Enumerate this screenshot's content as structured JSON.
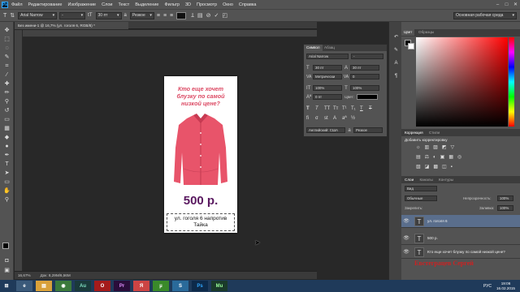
{
  "app": {
    "logo": "Ps"
  },
  "menu": [
    "Файл",
    "Редактирование",
    "Изображение",
    "Слои",
    "Текст",
    "Выделение",
    "Фильтр",
    "3D",
    "Просмотр",
    "Окно",
    "Справка"
  ],
  "options": {
    "font_family": "Arial Narrow",
    "font_style": "-",
    "font_size": "30 пт",
    "aa_label": "a",
    "aa_mode": "Резкое",
    "workspace": "Основная рабочая среда"
  },
  "document": {
    "tab_title": "Без имени-1 @ 16,7% (ул. гоголя 6, RGB/8) *",
    "zoom": "16,67%",
    "doc_info": "Док: 8,29M/6,56M",
    "headline": [
      "Кто еще хочет",
      "блузку по самой",
      "низкой цене?"
    ],
    "price": "500 р.",
    "address": [
      "ул. гоголя 6 напротив",
      "Тайка"
    ]
  },
  "character_panel": {
    "tabs": [
      "Символ",
      "Абзац"
    ],
    "font": "Arial Narrow",
    "style": "-",
    "size": "30 пт",
    "leading": "30 пт",
    "kerning": "Метрически",
    "tracking": "0",
    "scale_v": "100%",
    "scale_h": "100%",
    "baseline": "0 пт",
    "color_label": "Цвет:",
    "style_buttons": [
      "T",
      "T",
      "TT",
      "Tт",
      "T¹",
      "T₁",
      "T",
      "T"
    ],
    "language": "Английский: США",
    "aa_label": "a",
    "aa_mode": "Резкое"
  },
  "color_panel": {
    "tabs": [
      "Цвет",
      "Образцы"
    ]
  },
  "adjust_panel": {
    "tabs": [
      "Коррекция",
      "Стили"
    ],
    "title": "Добавить корректировку"
  },
  "layers_panel": {
    "tabs": [
      "Слои",
      "Каналы",
      "Контуры"
    ],
    "kind": "Вид",
    "blend": "Обычные",
    "opacity_label": "Непрозрачность:",
    "opacity": "100%",
    "lock_label": "Закрепить:",
    "fill_label": "Заливка:",
    "fill": "100%",
    "layers": [
      {
        "name": "ул. гоголя 6",
        "selected": true
      },
      {
        "name": "500 р.",
        "selected": false
      },
      {
        "name": "Кто еще хочет блузку по самой низкой цене?",
        "selected": false
      }
    ]
  },
  "watermark": "Евстеграцев Сергей",
  "taskbar": {
    "apps": [
      "Au",
      "Pr",
      "Ps",
      "Mu"
    ],
    "lang": "РУС",
    "time": "19:06",
    "date": "16.02.2015"
  }
}
